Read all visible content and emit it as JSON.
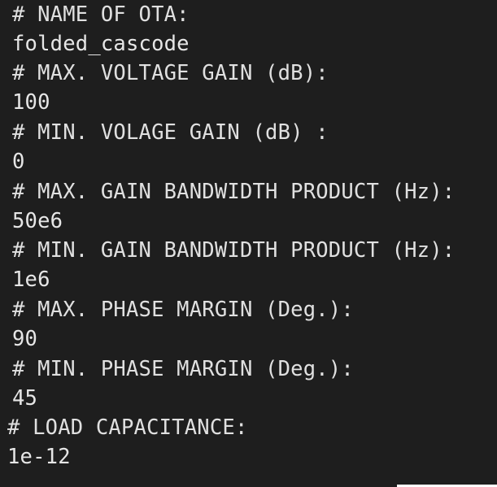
{
  "lines": [
    "# NAME OF OTA:",
    "folded_cascode",
    "# MAX. VOLTAGE GAIN (dB):",
    "100",
    "# MIN. VOLAGE GAIN (dB) :",
    "0",
    "# MAX. GAIN BANDWIDTH PRODUCT (Hz):",
    "50e6",
    "# MIN. GAIN BANDWIDTH PRODUCT (Hz):",
    "1e6",
    "# MAX. PHASE MARGIN (Deg.):",
    "90",
    "# MIN. PHASE MARGIN (Deg.):",
    "45",
    "# LOAD CAPACITANCE:",
    "1e-12"
  ]
}
